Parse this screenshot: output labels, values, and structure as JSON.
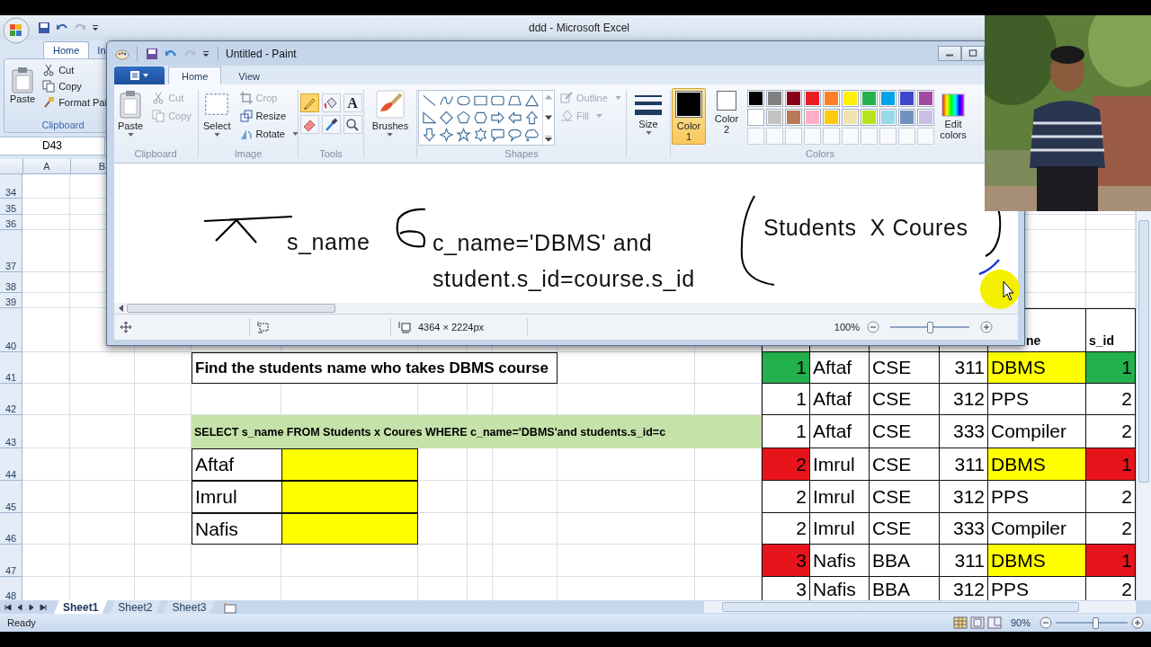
{
  "excel": {
    "title": "ddd - Microsoft Excel",
    "tabs": [
      {
        "label": "Home",
        "selected": true
      },
      {
        "label": "In",
        "selected": false
      }
    ],
    "clipboard": {
      "label": "Clipboard",
      "paste": "Paste",
      "cut": "Cut",
      "copy": "Copy",
      "format_painter": "Format Pai"
    },
    "name_box": "D43",
    "columns": [
      "A",
      "B"
    ],
    "rows": [
      "34",
      "35",
      "36",
      "37",
      "38",
      "39",
      "40",
      "41",
      "42",
      "43",
      "44",
      "45",
      "46",
      "47",
      "48"
    ],
    "question": "Find  the students name  who takes DBMS course",
    "query": "SELECT s_name FROM Students x Coures WHERE c_name='DBMS'and students.s_id=c",
    "answers": [
      {
        "name": "Aftaf",
        "color": "#ffff00"
      },
      {
        "name": "Imrul",
        "color": "#ffff00"
      },
      {
        "name": "Nafis",
        "color": "#ffff00"
      }
    ],
    "table": {
      "headers": [
        "ne",
        "s_id"
      ],
      "rows": [
        {
          "cells": [
            "1",
            "Aftaf",
            "CSE",
            "311",
            "DBMS",
            "1"
          ],
          "color": "#22b14c",
          "course_marked": true
        },
        {
          "cells": [
            "1",
            "Aftaf",
            "CSE",
            "312",
            "PPS",
            "2"
          ],
          "color": "#ffffff",
          "course_marked": false
        },
        {
          "cells": [
            "1",
            "Aftaf",
            "CSE",
            "333",
            "Compiler",
            "2"
          ],
          "color": "#ffffff",
          "course_marked": false
        },
        {
          "cells": [
            "2",
            "Imrul",
            "CSE",
            "311",
            "DBMS",
            "1"
          ],
          "color": "#e8141b",
          "course_marked": true
        },
        {
          "cells": [
            "2",
            "Imrul",
            "CSE",
            "312",
            "PPS",
            "2"
          ],
          "color": "#ffffff",
          "course_marked": false
        },
        {
          "cells": [
            "2",
            "Imrul",
            "CSE",
            "333",
            "Compiler",
            "2"
          ],
          "color": "#ffffff",
          "course_marked": false
        },
        {
          "cells": [
            "3",
            "Nafis",
            "BBA",
            "311",
            "DBMS",
            "1"
          ],
          "color": "#e8141b",
          "course_marked": true
        },
        {
          "cells": [
            "3",
            "Nafis",
            "BBA",
            "312",
            "PPS",
            "2"
          ],
          "color": "#ffffff",
          "course_marked": false
        }
      ]
    },
    "sheet_tabs": [
      {
        "label": "Sheet1",
        "selected": true
      },
      {
        "label": "Sheet2",
        "selected": false
      },
      {
        "label": "Sheet3",
        "selected": false
      }
    ],
    "status": "Ready",
    "zoom": {
      "label": "90%",
      "level": 0.55
    }
  },
  "paint": {
    "title": "Untitled - Paint",
    "tabs": [
      {
        "label": "Home",
        "selected": true
      },
      {
        "label": "View",
        "selected": false
      }
    ],
    "clipboard": {
      "label": "Clipboard",
      "paste": "Paste",
      "cut": {
        "label": "Cut",
        "disabled": true
      },
      "copy": {
        "label": "Copy",
        "disabled": true
      }
    },
    "image": {
      "label": "Image",
      "select": "Select",
      "crop": {
        "label": "Crop",
        "disabled": true
      },
      "resize": {
        "label": "Resize",
        "disabled": false
      },
      "rotate": "Rotate"
    },
    "tools": {
      "label": "Tools",
      "items": [
        {
          "kind": "pencil",
          "selected": true
        },
        {
          "kind": "fill",
          "selected": false
        },
        {
          "kind": "text",
          "glyph": "A",
          "selected": false
        },
        {
          "kind": "eraser",
          "selected": false
        },
        {
          "kind": "picker",
          "selected": false
        },
        {
          "kind": "magnifier",
          "selected": false
        }
      ]
    },
    "brushes": "Brushes",
    "shapes": {
      "label": "Shapes",
      "outline": {
        "label": "Outline",
        "disabled": true
      },
      "fill": {
        "label": "Fill",
        "disabled": true
      }
    },
    "size": "Size",
    "colors": {
      "label": "Colors",
      "slots": [
        {
          "label": "Color 1",
          "color": "#000000",
          "selected": true
        },
        {
          "label": "Color 2",
          "color": "#ffffff",
          "selected": false
        }
      ],
      "palette": [
        {
          "color": "#000000"
        },
        {
          "color": "#7f7f7f"
        },
        {
          "color": "#880015"
        },
        {
          "color": "#ed1c24"
        },
        {
          "color": "#ff7f27"
        },
        {
          "color": "#fff200"
        },
        {
          "color": "#22b14c"
        },
        {
          "color": "#00a2e8"
        },
        {
          "color": "#3f48cc"
        },
        {
          "color": "#a349a4"
        },
        {
          "color": "#ffffff"
        },
        {
          "color": "#c3c3c3"
        },
        {
          "color": "#b97a57"
        },
        {
          "color": "#ffaec9"
        },
        {
          "color": "#ffc90e"
        },
        {
          "color": "#efe4b0"
        },
        {
          "color": "#b5e61d"
        },
        {
          "color": "#99d9ea"
        },
        {
          "color": "#7092be"
        },
        {
          "color": "#c8bfe7"
        }
      ],
      "edit": "Edit colors"
    },
    "canvas": {
      "texts": [
        "s_name",
        "c_name='DBMS' and",
        "student.s_id=course.s_id",
        "Students  X Coures"
      ]
    },
    "status": {
      "size": "4364 × 2224px",
      "zoom": "100%",
      "level": 0.5
    }
  }
}
